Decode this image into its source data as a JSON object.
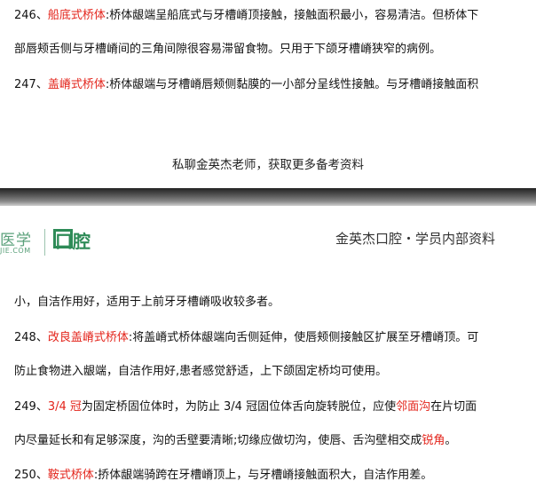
{
  "page1": {
    "item246": {
      "num": "246、",
      "term": "船底式桥体",
      "rest1": ":桥体龈端呈船底式与牙槽嵴顶接触，接触面积最小，容易清洁。但桥体下",
      "line2": "部唇颊舌侧与牙槽嵴间的三角间隙很容易滞留食物。只用于下颌牙槽嵴狭窄的病例。"
    },
    "item247": {
      "num": "247、",
      "term": "盖嵴式桥体",
      "rest1": ":桥体龈端与牙槽嵴唇颊侧黏膜的一小部分呈线性接触。与牙槽嵴接触面积"
    },
    "footer": "私聊金英杰老师，获取更多备考资料"
  },
  "page2": {
    "logo": {
      "cn": "医学",
      "url": "JIE.COM",
      "brand": "口腔"
    },
    "header_right": "金英杰口腔・学员内部资料",
    "cont_line": "小，自洁作用好，适用于上前牙牙槽嵴吸收较多者。",
    "item248": {
      "num": "248、",
      "term": "改良盖嵴式桥体",
      "rest1": ":将盖嵴式桥体龈端向舌侧延伸，使唇颊侧接触区扩展至牙槽嵴顶。可",
      "line2": "防止食物进入龈端，自洁作用好,患者感觉舒适，上下颌固定桥均可使用。"
    },
    "item249": {
      "num": "249、",
      "term": "3/4 冠",
      "rest1a": "为固定桥固位体时，为防止 3/4 冠固位体舌向旋转脱位，应使",
      "term2": "邻面沟",
      "rest1b": "在片切面",
      "line2a": "内尽量延长和有足够深度，沟的舌壁要清晰;切缘应做切沟，使唇、舌沟壁相交成",
      "term3": "锐角",
      "line2b": "。"
    },
    "item250": {
      "num": "250、",
      "term": "鞍式桥体",
      "rest1": ":挢体龈端骑跨在牙槽嵴顶上，与牙槽嵴接触面积大，自洁作用差。"
    }
  },
  "colors": {
    "highlight": "#e3241b",
    "brand_green": "#2e8b57"
  }
}
